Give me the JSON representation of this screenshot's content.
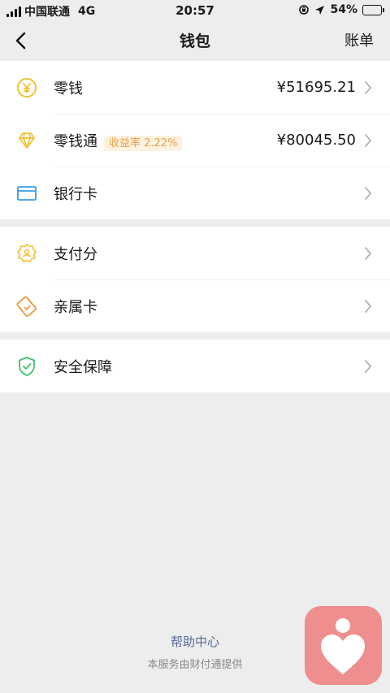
{
  "status_bar": {
    "carrier": "中国联通",
    "network": "4G",
    "time": "20:57",
    "battery": "54%",
    "battery_level": 0.54
  },
  "nav": {
    "title": "钱包",
    "right_label": "账单"
  },
  "sections": [
    {
      "rows": [
        {
          "label": "零钱",
          "value": "¥51695.21",
          "icon": "coin-icon"
        },
        {
          "label": "零钱通",
          "badge": "收益率 2.22%",
          "value": "¥80045.50",
          "icon": "diamond-icon"
        },
        {
          "label": "银行卡",
          "icon": "bank-card-icon"
        }
      ]
    },
    {
      "rows": [
        {
          "label": "支付分",
          "icon": "badge-icon"
        },
        {
          "label": "亲属卡",
          "icon": "family-card-icon"
        }
      ]
    },
    {
      "rows": [
        {
          "label": "安全保障",
          "icon": "shield-icon"
        }
      ]
    }
  ],
  "footer": {
    "help": "帮助中心",
    "provider": "本服务由财付通提供"
  },
  "colors": {
    "background": "#ededed",
    "gold": "#f0c12d",
    "link": "#576b95",
    "badge_text": "#e5a34a",
    "badge_bg": "#fdf1df",
    "bank_blue": "#3b9be8",
    "orange": "#f0973c",
    "green": "#3fbf6a",
    "float_button": "#ef8e8e"
  }
}
